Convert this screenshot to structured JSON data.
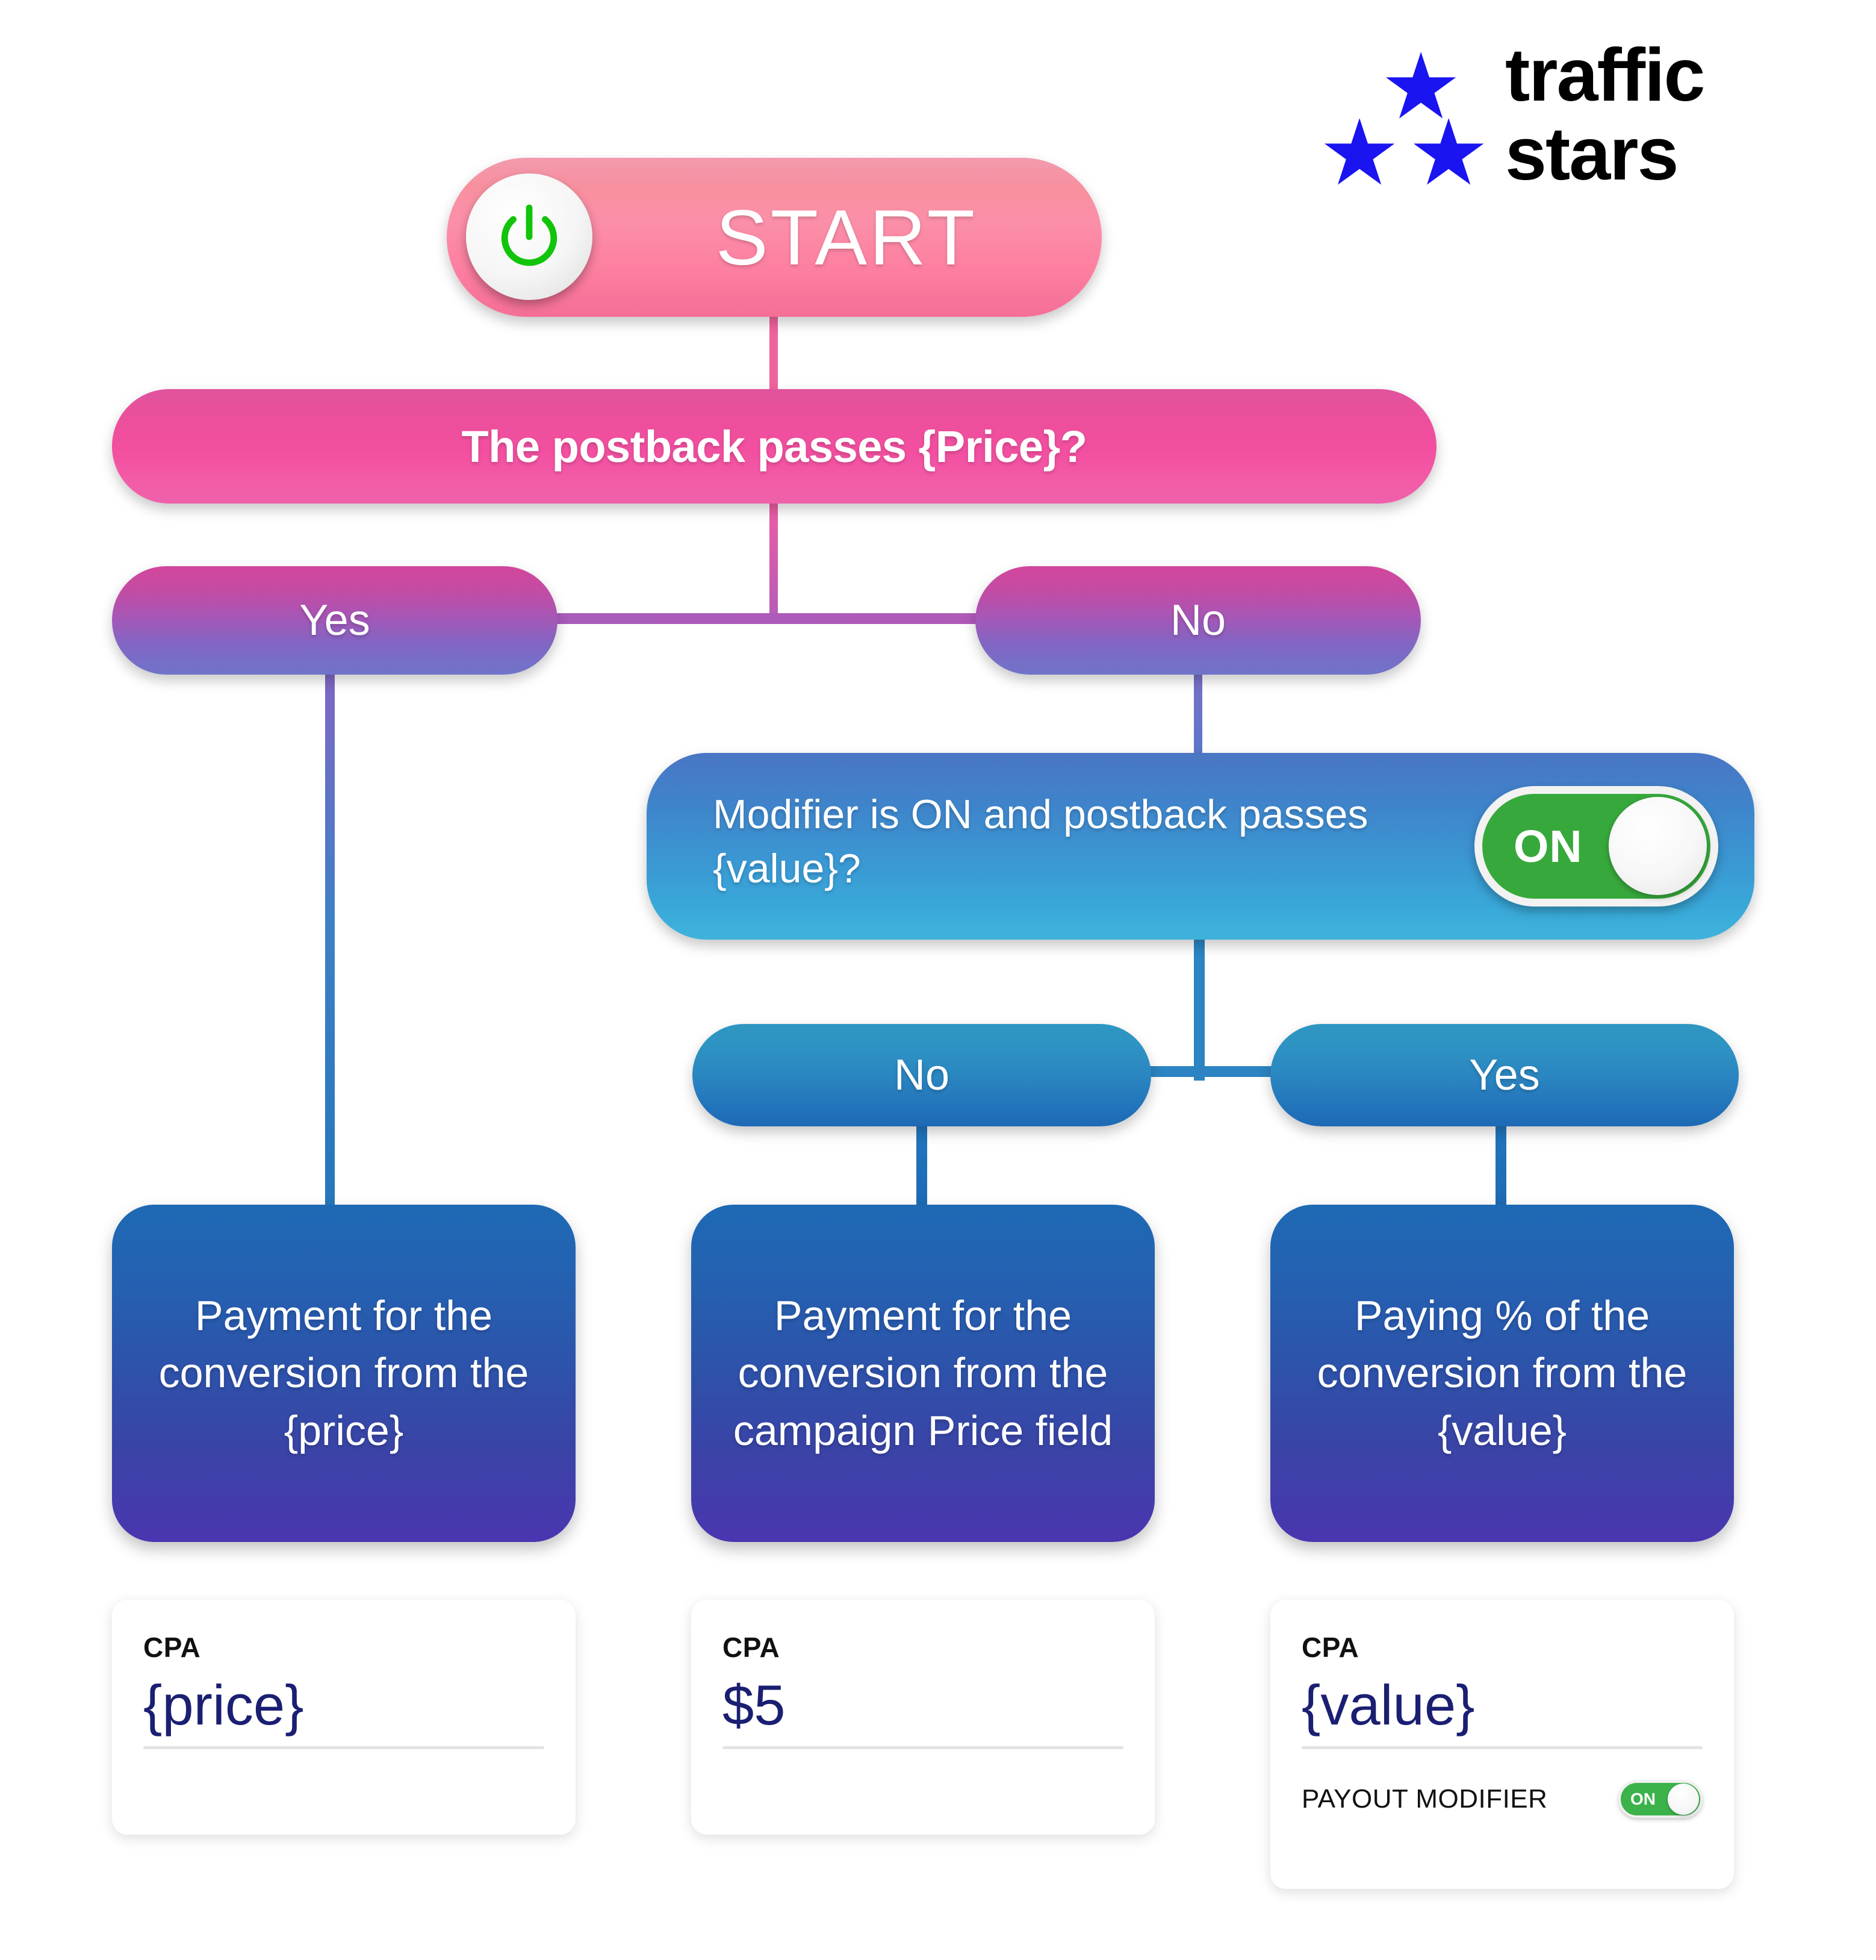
{
  "logo": {
    "line1": "traffic",
    "line2": "stars",
    "star_icon": "star-icon",
    "brand_color": "#1a14f0"
  },
  "flow": {
    "start": {
      "label": "START",
      "power_icon": "power-icon",
      "accent": "#fb8fa8"
    },
    "question1": {
      "label": "The postback passes {Price}?",
      "accent": "#f34fa0"
    },
    "branch1": {
      "yes": "Yes",
      "no": "No",
      "accent": "#a557b7"
    },
    "question2": {
      "label": "Modifier is ON and postback passes {value}?",
      "toggle_state": "ON",
      "accent": "#3a9ad4",
      "toggle_color": "#37a93c"
    },
    "branch2": {
      "no": "No",
      "yes": "Yes",
      "accent": "#2a84c0"
    },
    "results": [
      {
        "text": "Payment for the conversion from the {price}"
      },
      {
        "text": "Payment for the conversion from the campaign Price field"
      },
      {
        "text": "Paying % of the conversion from the {value}"
      }
    ]
  },
  "cpa_cards": [
    {
      "label": "CPA",
      "value": "{price}"
    },
    {
      "label": "CPA",
      "value": "$5"
    },
    {
      "label": "CPA",
      "value": "{value}",
      "payout_modifier_label": "PAYOUT MODIFIER",
      "payout_modifier_state": "ON"
    }
  ]
}
